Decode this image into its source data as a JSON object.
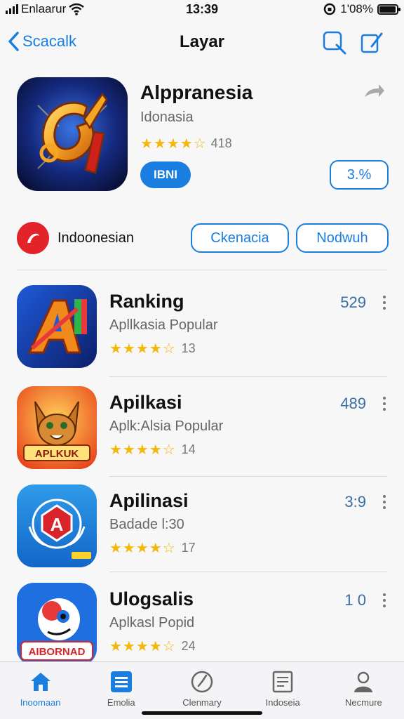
{
  "status_bar": {
    "carrier": "Enlaarur",
    "time": "13:39",
    "battery": "1'08%",
    "battery_level": 0.95
  },
  "nav": {
    "back_label": "Scacalk",
    "title": "Layar",
    "icons": [
      "search-icon",
      "compose-icon"
    ]
  },
  "featured": {
    "title": "Alppranesia",
    "subtitle": "Idonasia",
    "stars": "★★★★☆",
    "rating_count": "418",
    "rating": 3.5,
    "get_label": "IBNI",
    "price_label": "3.%",
    "icon": "game-logo-icon"
  },
  "filter": {
    "region_label": "Indoonesian",
    "buttons": [
      "Ckenacia",
      "Nodwuh"
    ]
  },
  "apps": [
    {
      "name": "Ranking",
      "subtitle": "Apllkasia Popular",
      "stars": "★★★★☆",
      "rating": 3.5,
      "rating_count": "13",
      "count": "529",
      "icon": "letter-a-game-icon"
    },
    {
      "name": "Apilkasi",
      "subtitle": "Aplk:Alsia Popular",
      "stars": "★★★★☆",
      "rating": 3.5,
      "rating_count": "14",
      "count": "489",
      "icon": "cat-mascot-icon"
    },
    {
      "name": "Apilinasi",
      "subtitle": "Badade l:30",
      "stars": "★★★★☆",
      "rating": 3.5,
      "rating_count": "17",
      "count": "3:9",
      "icon": "crest-shield-icon"
    },
    {
      "name": "Ulogsalis",
      "subtitle": "Aplkasl Popid",
      "stars": "★★★★☆",
      "rating": 3.5,
      "rating_count": "24",
      "count": "1 0",
      "icon": "ghost-mascot-icon",
      "icon_text": "AIBORNAD"
    }
  ],
  "tabs": [
    {
      "label": "Inoomaan",
      "icon": "home-icon",
      "active": true
    },
    {
      "label": "Emolia",
      "icon": "list-icon",
      "active": false
    },
    {
      "label": "Clenmary",
      "icon": "clock-icon",
      "active": false
    },
    {
      "label": "Indoseia",
      "icon": "document-icon",
      "active": false
    },
    {
      "label": "Necmure",
      "icon": "profile-icon",
      "active": false
    }
  ],
  "colors": {
    "accent": "#1a7ee0",
    "star": "#f3b80b",
    "region_badge": "#e2232a"
  }
}
